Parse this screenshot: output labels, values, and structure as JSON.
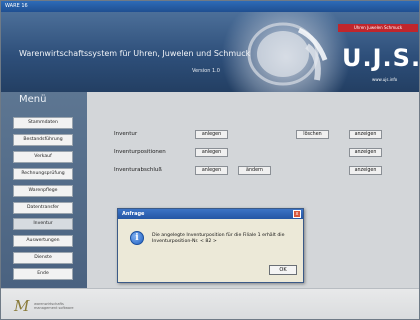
{
  "window": {
    "title": "WARE 16"
  },
  "banner": {
    "title": "Warenwirtschaftssystem für Uhren, Juwelen und Schmuck",
    "version": "Version 1.0"
  },
  "logo": {
    "tagline": "Uhren Juwelen Schmuck",
    "text": "U.J.S.",
    "url": "www.ujs.info"
  },
  "sidebar": {
    "title": "Menü",
    "items": [
      {
        "label": "Stammdaten"
      },
      {
        "label": "Bestandsführung"
      },
      {
        "label": "Verkauf"
      },
      {
        "label": "Rechnungsprüfung"
      },
      {
        "label": "Warenpflege"
      },
      {
        "label": "Datentransfer"
      },
      {
        "label": "Inventur",
        "active": true
      },
      {
        "label": "Auswertungen"
      },
      {
        "label": "Dienste"
      },
      {
        "label": "Ende"
      }
    ]
  },
  "content": {
    "rows": [
      {
        "label": "Inventur",
        "buttons": [
          "anlegen",
          "löschen",
          "anzeigen"
        ]
      },
      {
        "label": "Inventurpositionen",
        "buttons": [
          "anlegen",
          "anzeigen"
        ]
      },
      {
        "label": "Inventurabschluß",
        "buttons": [
          "anlegen",
          "ändern",
          "anzeigen"
        ]
      }
    ]
  },
  "dialog": {
    "title": "Anfrage",
    "message": "Die angelegte Inventurposition für die Filiale 1 erhält die Inventurposition-Nr. < 82 >",
    "ok_label": "OK",
    "close_label": "x"
  },
  "footer": {
    "logo": "M",
    "text": "warenwirtschafts management software"
  },
  "colors": {
    "titlebar": "#1f4f91",
    "banner": "#2e4f7a",
    "sidebar": "#4a6280",
    "logo_tag": "#c0262c",
    "content": "#d3d6d9"
  }
}
